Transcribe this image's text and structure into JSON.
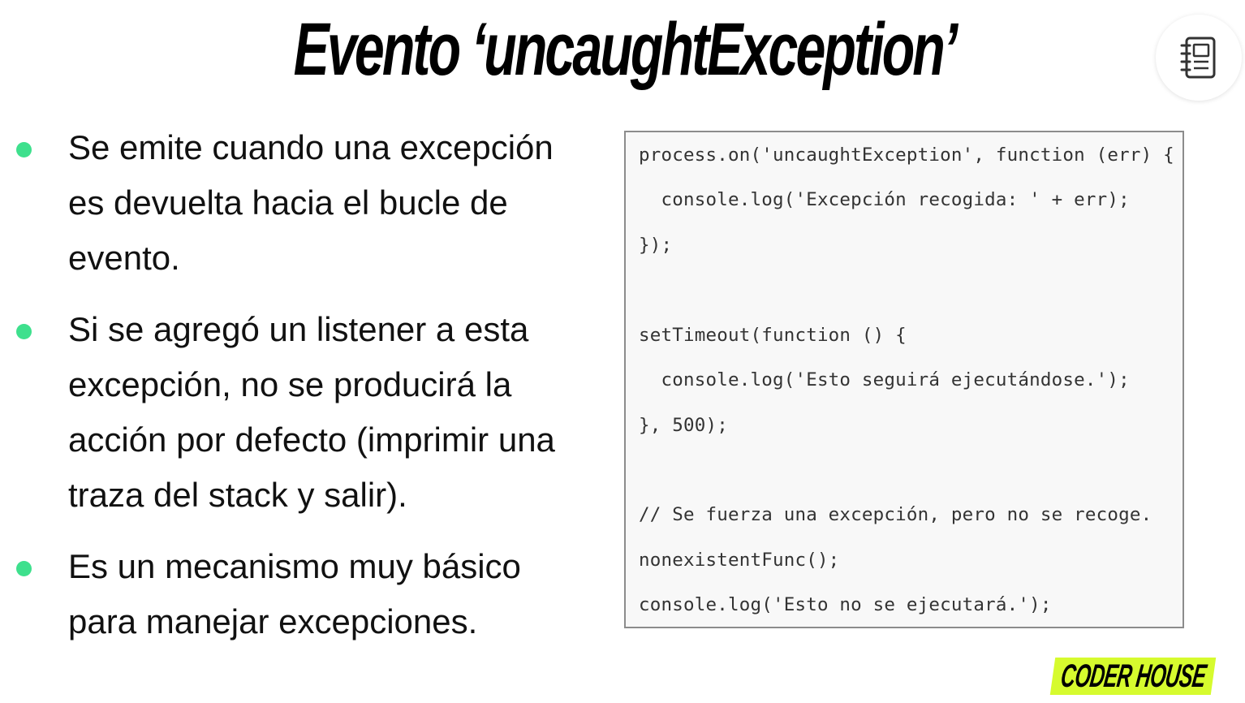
{
  "slide": {
    "title": "Evento ‘uncaughtException’",
    "bullets": [
      {
        "text": "Se emite cuando una excepción es devuelta hacia el bucle de evento."
      },
      {
        "text": "Si se agregó un listener a esta excepción, no se producirá la acción por defecto (imprimir una traza del stack y salir)."
      },
      {
        "text": "Es un mecanismo muy básico para manejar excepciones."
      }
    ],
    "code_lines": [
      "process.on('uncaughtException', function (err) {",
      "  console.log('Excepción recogida: ' + err);",
      "});",
      "setTimeout(function () {",
      "  console.log('Esto seguirá ejecutándose.');",
      "}, 500);",
      "// Se fuerza una excepción, pero no se recoge.",
      "nonexistentFunc();",
      "console.log('Esto no se ejecutará.');"
    ],
    "logo_text": "CODER HOUSE",
    "notes_icon": "notebook-icon",
    "colors": {
      "bullet": "#3ee08d",
      "logo_background": "#d6fb2e",
      "code_background": "#f8f8f8",
      "code_border": "#8c8c8c"
    }
  }
}
